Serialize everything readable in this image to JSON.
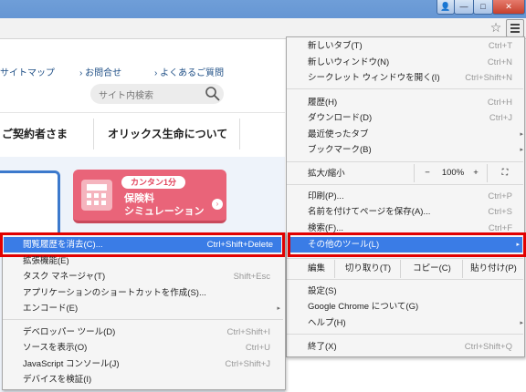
{
  "window": {
    "controls": [
      "👤",
      "—",
      "□",
      "✕"
    ]
  },
  "page": {
    "toplinks": [
      "サイトマップ",
      "› お問合せ",
      "› よくあるご質問"
    ],
    "search_placeholder": "サイト内検索",
    "nav": [
      "ご契約者さま",
      "オリックス生命について"
    ],
    "banner": {
      "badge": "カンタン1分",
      "line1": "保険料",
      "line2": "シミュレーション",
      "arrow": "›"
    }
  },
  "main_menu": {
    "items_top": [
      {
        "label": "新しいタブ(T)",
        "shortcut": "Ctrl+T"
      },
      {
        "label": "新しいウィンドウ(N)",
        "shortcut": "Ctrl+N"
      },
      {
        "label": "シークレット ウィンドウを開く(I)",
        "shortcut": "Ctrl+Shift+N"
      }
    ],
    "items_history": [
      {
        "label": "履歴(H)",
        "shortcut": "Ctrl+H"
      },
      {
        "label": "ダウンロード(D)",
        "shortcut": "Ctrl+J"
      },
      {
        "label": "最近使ったタブ",
        "shortcut": "▸"
      },
      {
        "label": "ブックマーク(B)",
        "shortcut": "▸"
      }
    ],
    "zoom": {
      "label": "拡大/縮小",
      "minus": "−",
      "value": "100%",
      "plus": "+",
      "fullscreen": "⛶"
    },
    "items_print": [
      {
        "label": "印刷(P)...",
        "shortcut": "Ctrl+P"
      },
      {
        "label": "名前を付けてページを保存(A)...",
        "shortcut": "Ctrl+S"
      },
      {
        "label": "検索(F)...",
        "shortcut": "Ctrl+F"
      }
    ],
    "more_tools": {
      "label": "その他のツール(L)",
      "arrow": "▸"
    },
    "edit": {
      "label": "編集",
      "cut": "切り取り(T)",
      "copy": "コピー(C)",
      "paste": "貼り付け(P)"
    },
    "items_settings": [
      {
        "label": "設定(S)",
        "shortcut": ""
      },
      {
        "label": "Google Chrome について(G)",
        "shortcut": ""
      },
      {
        "label": "ヘルプ(H)",
        "shortcut": "▸"
      }
    ],
    "exit": {
      "label": "終了(X)",
      "shortcut": "Ctrl+Shift+Q"
    }
  },
  "sub_menu": {
    "items": [
      {
        "label": "閲覧履歴を消去(C)...",
        "shortcut": "Ctrl+Shift+Delete"
      },
      {
        "label": "拡張機能(E)",
        "shortcut": ""
      },
      {
        "label": "タスク マネージャ(T)",
        "shortcut": "Shift+Esc"
      },
      {
        "label": "アプリケーションのショートカットを作成(S)...",
        "shortcut": ""
      },
      {
        "label": "エンコード(E)",
        "shortcut": "▸"
      },
      {
        "label": "デベロッパー ツール(D)",
        "shortcut": "Ctrl+Shift+I"
      },
      {
        "label": "ソースを表示(O)",
        "shortcut": "Ctrl+U"
      },
      {
        "label": "JavaScript コンソール(J)",
        "shortcut": "Ctrl+Shift+J"
      },
      {
        "label": "デバイスを検証(I)",
        "shortcut": ""
      }
    ]
  },
  "colors": {
    "highlight": "#3a7ce6",
    "callout": "#e10000",
    "banner": "#e96479",
    "link": "#1f4f86"
  }
}
